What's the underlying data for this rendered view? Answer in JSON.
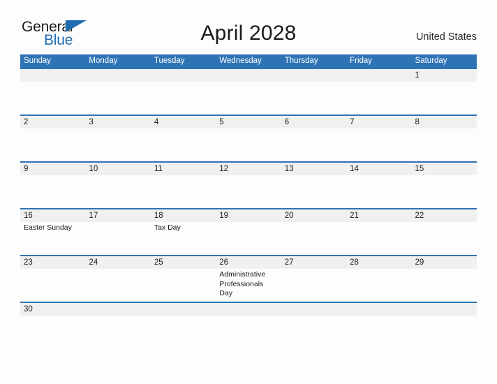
{
  "brand": {
    "name_part1": "General",
    "name_part2": "Blue",
    "flag_icon": "triangle-flag-icon",
    "accent_color": "#1f6cb0"
  },
  "header": {
    "month_title": "April 2028",
    "country": "United States"
  },
  "theme": {
    "header_blue": "#2e74b5",
    "day_band_gray": "#f0f0f0",
    "page_background": "#fdfdfd",
    "text_color": "#1a1a1a"
  },
  "calendar": {
    "month": "April",
    "year": "2028",
    "weekday_headers": [
      "Sunday",
      "Monday",
      "Tuesday",
      "Wednesday",
      "Thursday",
      "Friday",
      "Saturday"
    ],
    "weeks": [
      [
        {
          "date": ""
        },
        {
          "date": ""
        },
        {
          "date": ""
        },
        {
          "date": ""
        },
        {
          "date": ""
        },
        {
          "date": ""
        },
        {
          "date": "1"
        }
      ],
      [
        {
          "date": "2"
        },
        {
          "date": "3"
        },
        {
          "date": "4"
        },
        {
          "date": "5"
        },
        {
          "date": "6"
        },
        {
          "date": "7"
        },
        {
          "date": "8"
        }
      ],
      [
        {
          "date": "9"
        },
        {
          "date": "10"
        },
        {
          "date": "11"
        },
        {
          "date": "12"
        },
        {
          "date": "13"
        },
        {
          "date": "14"
        },
        {
          "date": "15"
        }
      ],
      [
        {
          "date": "16",
          "event": "Easter Sunday"
        },
        {
          "date": "17"
        },
        {
          "date": "18",
          "event": "Tax Day"
        },
        {
          "date": "19"
        },
        {
          "date": "20"
        },
        {
          "date": "21"
        },
        {
          "date": "22"
        }
      ],
      [
        {
          "date": "23"
        },
        {
          "date": "24"
        },
        {
          "date": "25"
        },
        {
          "date": "26",
          "event": "Administrative Professionals Day"
        },
        {
          "date": "27"
        },
        {
          "date": "28"
        },
        {
          "date": "29"
        }
      ],
      [
        {
          "date": "30"
        },
        {
          "date": ""
        },
        {
          "date": ""
        },
        {
          "date": ""
        },
        {
          "date": ""
        },
        {
          "date": ""
        },
        {
          "date": ""
        }
      ]
    ]
  }
}
